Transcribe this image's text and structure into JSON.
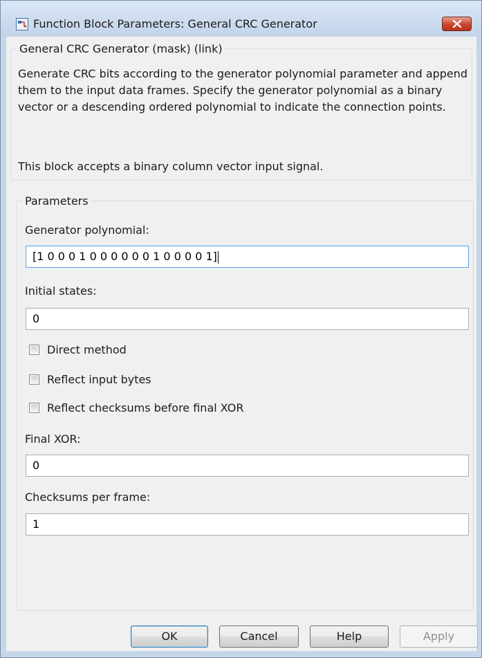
{
  "window": {
    "title": "Function Block Parameters: General CRC Generator"
  },
  "mask_group": {
    "legend": "General CRC Generator (mask) (link)",
    "description": "Generate CRC bits according to the generator polynomial parameter and append them to the input data frames. Specify the generator polynomial as a binary vector or a descending ordered polynomial to indicate the connection points.",
    "note": "This block accepts a binary column vector input signal."
  },
  "parameters": {
    "legend": "Parameters",
    "generator_polynomial": {
      "label": "Generator polynomial:",
      "value": "[1 0 0 0 1 0 0 0 0 0 0 1 0 0 0 0 1]"
    },
    "initial_states": {
      "label": "Initial states:",
      "value": "0"
    },
    "direct_method": {
      "label": "Direct method",
      "checked": false
    },
    "reflect_input_bytes": {
      "label": "Reflect input bytes",
      "checked": false
    },
    "reflect_checksums": {
      "label": "Reflect checksums before final XOR",
      "checked": false
    },
    "final_xor": {
      "label": "Final XOR:",
      "value": "0"
    },
    "checksums_per_frame": {
      "label": "Checksums per frame:",
      "value": "1"
    }
  },
  "buttons": {
    "ok": "OK",
    "cancel": "Cancel",
    "help": "Help",
    "apply": "Apply"
  },
  "icons": {
    "app": "simulink-block-icon",
    "close": "close-icon"
  },
  "colors": {
    "titlebar": "#c6d6ea",
    "close_button": "#c9452b",
    "dialog_background": "#f0f0f0"
  }
}
